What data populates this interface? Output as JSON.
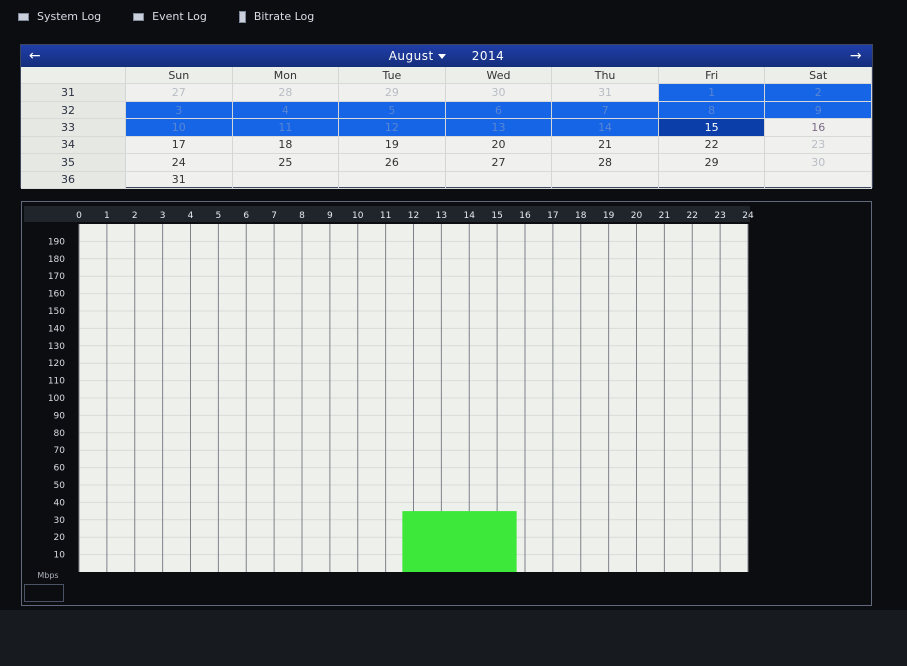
{
  "tabs": [
    {
      "label": "System Log",
      "icon": "log-icon"
    },
    {
      "label": "Event Log",
      "icon": "log-icon"
    },
    {
      "label": "Bitrate Log",
      "icon": "document-icon"
    }
  ],
  "calendar": {
    "month": "August",
    "year": "2014",
    "day_names": [
      "Sun",
      "Mon",
      "Tue",
      "Wed",
      "Thu",
      "Fri",
      "Sat"
    ],
    "weeks": [
      {
        "week": "31",
        "days": [
          "27",
          "28",
          "29",
          "30",
          "31",
          "1",
          "2"
        ]
      },
      {
        "week": "32",
        "days": [
          "3",
          "4",
          "5",
          "6",
          "7",
          "8",
          "9"
        ]
      },
      {
        "week": "33",
        "days": [
          "10",
          "11",
          "12",
          "13",
          "14",
          "15",
          "16"
        ]
      },
      {
        "week": "34",
        "days": [
          "17",
          "18",
          "19",
          "20",
          "21",
          "22",
          "23"
        ]
      },
      {
        "week": "35",
        "days": [
          "24",
          "25",
          "26",
          "27",
          "28",
          "29",
          "30"
        ]
      },
      {
        "week": "36",
        "days": [
          "31",
          "",
          "",
          "",
          "",
          "",
          ""
        ]
      }
    ],
    "selected_day": "15",
    "colors": {
      "header": "#1f3ea8",
      "selected": "#1565e6",
      "today": "#0b3ea8"
    }
  },
  "chart_data": {
    "type": "bar",
    "x_ticks": [
      "0",
      "1",
      "2",
      "3",
      "4",
      "5",
      "6",
      "7",
      "8",
      "9",
      "10",
      "11",
      "12",
      "13",
      "14",
      "15",
      "16",
      "17",
      "18",
      "19",
      "20",
      "21",
      "22",
      "23",
      "24"
    ],
    "y_ticks": [
      "10",
      "20",
      "30",
      "40",
      "50",
      "60",
      "70",
      "80",
      "90",
      "100",
      "110",
      "120",
      "130",
      "140",
      "150",
      "160",
      "170",
      "180",
      "190"
    ],
    "ylabel": "Mbps",
    "xlim": [
      0,
      24
    ],
    "ylim": [
      0,
      200
    ],
    "grid": true,
    "series": [
      {
        "x_start": 11.6,
        "x_end": 15.7,
        "value": 35,
        "color": "#3ee83a"
      }
    ]
  }
}
